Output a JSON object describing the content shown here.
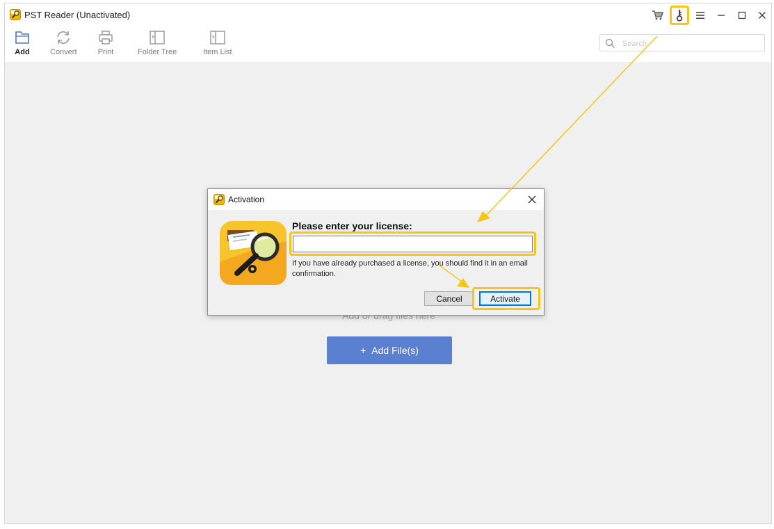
{
  "window": {
    "title": "PST Reader (Unactivated)",
    "controls": [
      "cart-icon",
      "key-icon",
      "menu-icon",
      "minimize-icon",
      "maximize-icon",
      "close-icon"
    ]
  },
  "toolbar": {
    "items": [
      {
        "label": "Add",
        "icon": "add-file-icon",
        "active": true
      },
      {
        "label": "Convert",
        "icon": "convert-icon",
        "active": false
      },
      {
        "label": "Print",
        "icon": "printer-icon",
        "active": false
      },
      {
        "label": "Folder Tree",
        "icon": "folder-tree-icon",
        "active": false
      },
      {
        "label": "Item List",
        "icon": "item-list-icon",
        "active": false
      }
    ]
  },
  "search": {
    "placeholder": "Search",
    "value": ""
  },
  "main": {
    "drop_hint": "Add or drag files here",
    "add_files_label": "Add File(s)",
    "add_files_icon": "+"
  },
  "dialog": {
    "title": "Activation",
    "heading": "Please enter your license:",
    "license_value": "",
    "note": "If you have already purchased a license, you should find it in an email confirmation.",
    "cancel_label": "Cancel",
    "activate_label": "Activate"
  },
  "colors": {
    "highlight": "#f7c613",
    "accent_button": "#5b7fd1",
    "focus_border": "#0078d7",
    "background": "#f0f0f0"
  }
}
